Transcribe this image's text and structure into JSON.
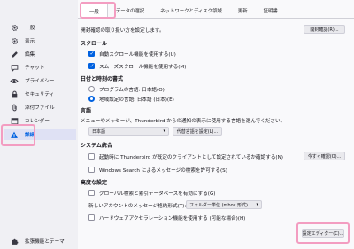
{
  "sidebar": {
    "items": [
      {
        "label": "一般",
        "icon": "gear-icon"
      },
      {
        "label": "表示",
        "icon": "gear-icon"
      },
      {
        "label": "編集",
        "icon": "pencil-icon"
      },
      {
        "label": "チャット",
        "icon": "chat-icon"
      },
      {
        "label": "プライバシー",
        "icon": "eye-icon"
      },
      {
        "label": "セキュリティ",
        "icon": "lock-icon"
      },
      {
        "label": "添付ファイル",
        "icon": "paperclip-icon"
      },
      {
        "label": "カレンダー",
        "icon": "calendar-icon"
      },
      {
        "label": "詳細",
        "icon": "warning-icon"
      }
    ],
    "bottom_label": "拡張機能とテーマ"
  },
  "tabs": [
    {
      "label": "一般"
    },
    {
      "label": "データの選択"
    },
    {
      "label": "ネットワークとディスク領域"
    },
    {
      "label": "更新"
    },
    {
      "label": "証明書"
    }
  ],
  "general": {
    "description": "開封確認の取り扱い方を設定します。",
    "receipts_button": "開封確認(R)..."
  },
  "scroll": {
    "heading": "スクロール",
    "autoscroll": "自動スクロール機能を使用する(U)",
    "smooth": "スムーズスクロール機能を使用する(M)"
  },
  "datetime": {
    "heading": "日付と時刻の書式",
    "app_locale": "プログラムの言語: 日本語(O)",
    "regional": "地域設定の言語: 日本語 (日本)(E)"
  },
  "language": {
    "heading": "言語",
    "description": "メニューやメッセージ、Thunderbird からの通知の表示に使用する言語を選んでください。",
    "selected": "日本語",
    "alternatives_button": "代替言語を設定(L)..."
  },
  "system": {
    "heading": "システム統合",
    "default_client": "起動時に Thunderbird が既定のクライアントとして設定されているか確認する(N)",
    "check_now_button": "今すぐ確認(O)...",
    "windows_search": "Windows Search によるメッセージの検索を許可する(S)"
  },
  "advanced": {
    "heading": "高度な設定",
    "global_search": "グローバル検索と索引データベースを有効にする(G)",
    "storage_label": "新しいアカウントのメッセージ格納形式(T):",
    "storage_selected": "フォルダー単位 (mbox 形式)",
    "hardware_accel": "ハードウェアアクセラレーション機能を使用する (可能な場合)(H)",
    "config_editor_button": "設定エディター(C)..."
  }
}
